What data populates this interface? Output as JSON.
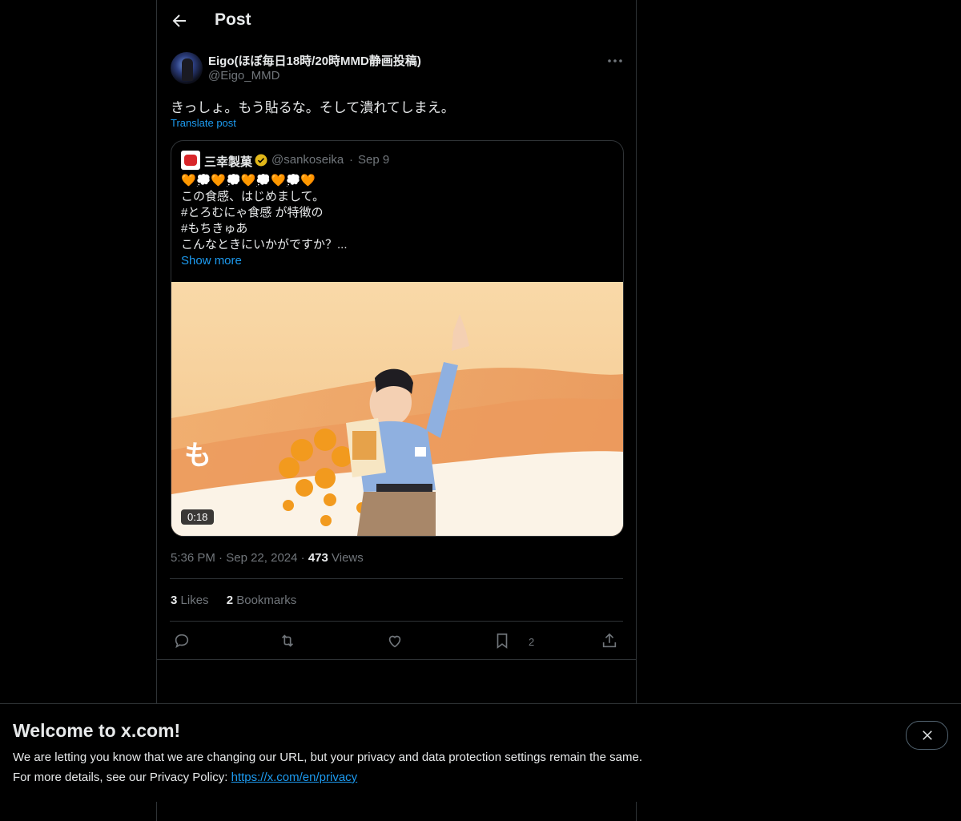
{
  "header": {
    "title": "Post"
  },
  "post": {
    "author_name": "Eigo(ほぼ毎日18時/20時MMD静画投稿)",
    "author_handle": "@Eigo_MMD",
    "text": "きっしょ。もう貼るな。そして潰れてしまえ。",
    "translate_label": "Translate post",
    "time": "5:36 PM",
    "date": "Sep 22, 2024",
    "views_count": "473",
    "views_label": "Views",
    "likes_count": "3",
    "likes_label": "Likes",
    "bookmarks_count": "2",
    "bookmarks_label": "Bookmarks",
    "bookmark_action_count": "2"
  },
  "quote": {
    "author_name": "三幸製菓",
    "author_handle": "@sankoseika",
    "date": "Sep 9",
    "lines": [
      "🧡💭🧡💭🧡💭🧡💭🧡",
      "この食感、はじめまして。",
      "#とろむにゃ食感 が特徴の",
      "#もちきゅあ",
      "こんなときにいかがですか？..."
    ],
    "show_more": "Show more",
    "video_duration": "0:18"
  },
  "banner": {
    "title": "Welcome to x.com!",
    "line1": "We are letting you know that we are changing our URL, but your privacy and data protection settings remain the same.",
    "line2_prefix": "For more details, see our Privacy Policy:",
    "link": "https://x.com/en/privacy"
  },
  "colors": {
    "accent": "#1d9bf0",
    "border": "#2f3336",
    "muted": "#71767b",
    "background": "#000000"
  },
  "icons": [
    "back-arrow-icon",
    "more-icon",
    "verified-badge-icon",
    "reply-icon",
    "repost-icon",
    "like-icon",
    "bookmark-icon",
    "share-icon",
    "close-icon"
  ]
}
